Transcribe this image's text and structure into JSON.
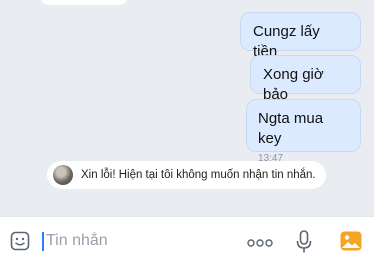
{
  "messages": [
    {
      "text": "Cungz lấy tiền"
    },
    {
      "text": "Xong giờ bảo"
    },
    {
      "text": "Ngta mua key",
      "time": "13:47"
    }
  ],
  "notice": {
    "text": "Xin lỗi! Hiện tại tôi không muốn nhận tin nhắn."
  },
  "composer": {
    "placeholder": "Tin nhắn"
  },
  "icons": {
    "emoji": "emoji-icon",
    "more": "more-icon",
    "mic": "microphone-icon",
    "image": "image-icon"
  },
  "colors": {
    "background": "#e9ecf1",
    "bubble_sent": "#dbeaff",
    "accent": "#2f7df6",
    "image_icon": "#f5a524"
  }
}
